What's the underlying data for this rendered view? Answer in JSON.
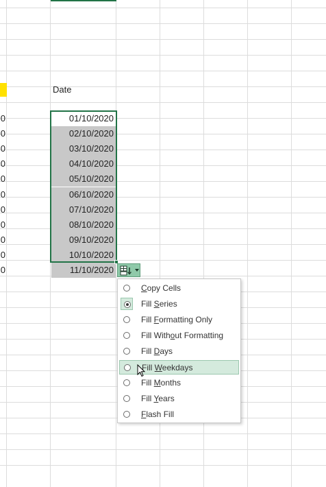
{
  "sheet": {
    "header_label": "Date",
    "left_column_values": [
      "0",
      "0",
      "0",
      "0",
      "0",
      "0",
      "0",
      "0",
      "0",
      "0",
      "0"
    ],
    "selected_dates": [
      "01/10/2020",
      "02/10/2020",
      "03/10/2020",
      "04/10/2020",
      "05/10/2020",
      "06/10/2020",
      "07/10/2020",
      "08/10/2020",
      "09/10/2020",
      "10/10/2020",
      "11/10/2020"
    ]
  },
  "autofill_button": {
    "icon": "auto-fill-options-icon"
  },
  "autofill_menu": {
    "selected_option": "Fill Series",
    "hovered_option": "Fill Weekdays",
    "items": [
      {
        "label": "Copy Cells",
        "pre": "",
        "accel": "C",
        "post": "opy Cells"
      },
      {
        "label": "Fill Series",
        "pre": "Fill ",
        "accel": "S",
        "post": "eries"
      },
      {
        "label": "Fill Formatting Only",
        "pre": "Fill ",
        "accel": "F",
        "post": "ormatting Only"
      },
      {
        "label": "Fill Without Formatting",
        "pre": "Fill With",
        "accel": "o",
        "post": "ut Formatting"
      },
      {
        "label": "Fill Days",
        "pre": "Fill ",
        "accel": "D",
        "post": "ays"
      },
      {
        "label": "Fill Weekdays",
        "pre": "Fill ",
        "accel": "W",
        "post": "eekdays"
      },
      {
        "label": "Fill Months",
        "pre": "Fill ",
        "accel": "M",
        "post": "onths"
      },
      {
        "label": "Fill Years",
        "pre": "Fill ",
        "accel": "Y",
        "post": "ears"
      },
      {
        "label": "Flash Fill",
        "pre": "",
        "accel": "F",
        "post": "lash Fill"
      }
    ]
  },
  "colors": {
    "selection_border": "#217346",
    "selected_fill": "#c8c8c8",
    "highlight": "#d4eadd",
    "yellow_cell": "#ffe100"
  }
}
